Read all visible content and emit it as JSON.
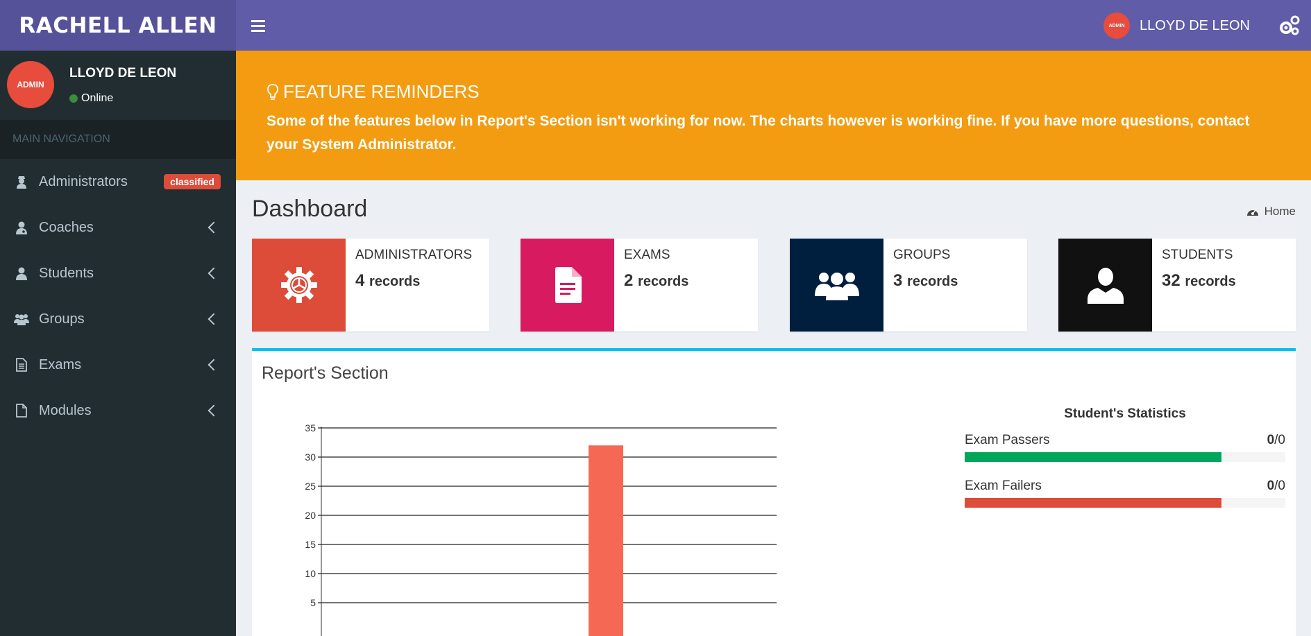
{
  "header": {
    "logo": "RACHELL ALLEN",
    "user_avatar": "ADMIN",
    "user_name": "LLOYD DE LEON"
  },
  "sidebar": {
    "avatar": "ADMIN",
    "user_name": "LLOYD DE LEON",
    "status": "Online",
    "nav_header": "MAIN NAVIGATION",
    "items": [
      {
        "label": "Administrators",
        "icon": "user-secret-icon",
        "badge": "classified"
      },
      {
        "label": "Coaches",
        "icon": "user-md-icon"
      },
      {
        "label": "Students",
        "icon": "user-icon"
      },
      {
        "label": "Groups",
        "icon": "users-icon"
      },
      {
        "label": "Exams",
        "icon": "file-text-icon"
      },
      {
        "label": "Modules",
        "icon": "file-icon"
      }
    ]
  },
  "reminder": {
    "title": "FEATURE REMINDERS",
    "text": "Some of the features below in Report's Section isn't working for now. The charts however is working fine. If you have more questions, contact your System Administrator."
  },
  "page": {
    "title": "Dashboard",
    "breadcrumb": "Home"
  },
  "info_boxes": [
    {
      "label": "ADMINISTRATORS",
      "count": "4",
      "unit": "records",
      "color": "#dd4b39",
      "icon": "gear-icon"
    },
    {
      "label": "EXAMS",
      "count": "2",
      "unit": "records",
      "color": "#d81b60",
      "icon": "file-text-icon"
    },
    {
      "label": "GROUPS",
      "count": "3",
      "unit": "records",
      "color": "#001f3f",
      "icon": "users-icon"
    },
    {
      "label": "STUDENTS",
      "count": "32",
      "unit": "records",
      "color": "#111111",
      "icon": "user-icon"
    }
  ],
  "report": {
    "title": "Report's Section",
    "stats_title": "Student's Statistics",
    "stats": [
      {
        "label": "Exam Passers",
        "value": "0",
        "total": "/0",
        "color": "#00a65a",
        "fill": 0.8
      },
      {
        "label": "Exam Failers",
        "value": "0",
        "total": "/0",
        "color": "#dd4b39",
        "fill": 0.8
      }
    ]
  },
  "chart_data": {
    "type": "bar",
    "yticks": [
      "35",
      "30",
      "25",
      "20",
      "15",
      "10",
      "5"
    ],
    "ylim": [
      0,
      35
    ],
    "values": [
      32
    ],
    "bar_color": "#f56954"
  }
}
